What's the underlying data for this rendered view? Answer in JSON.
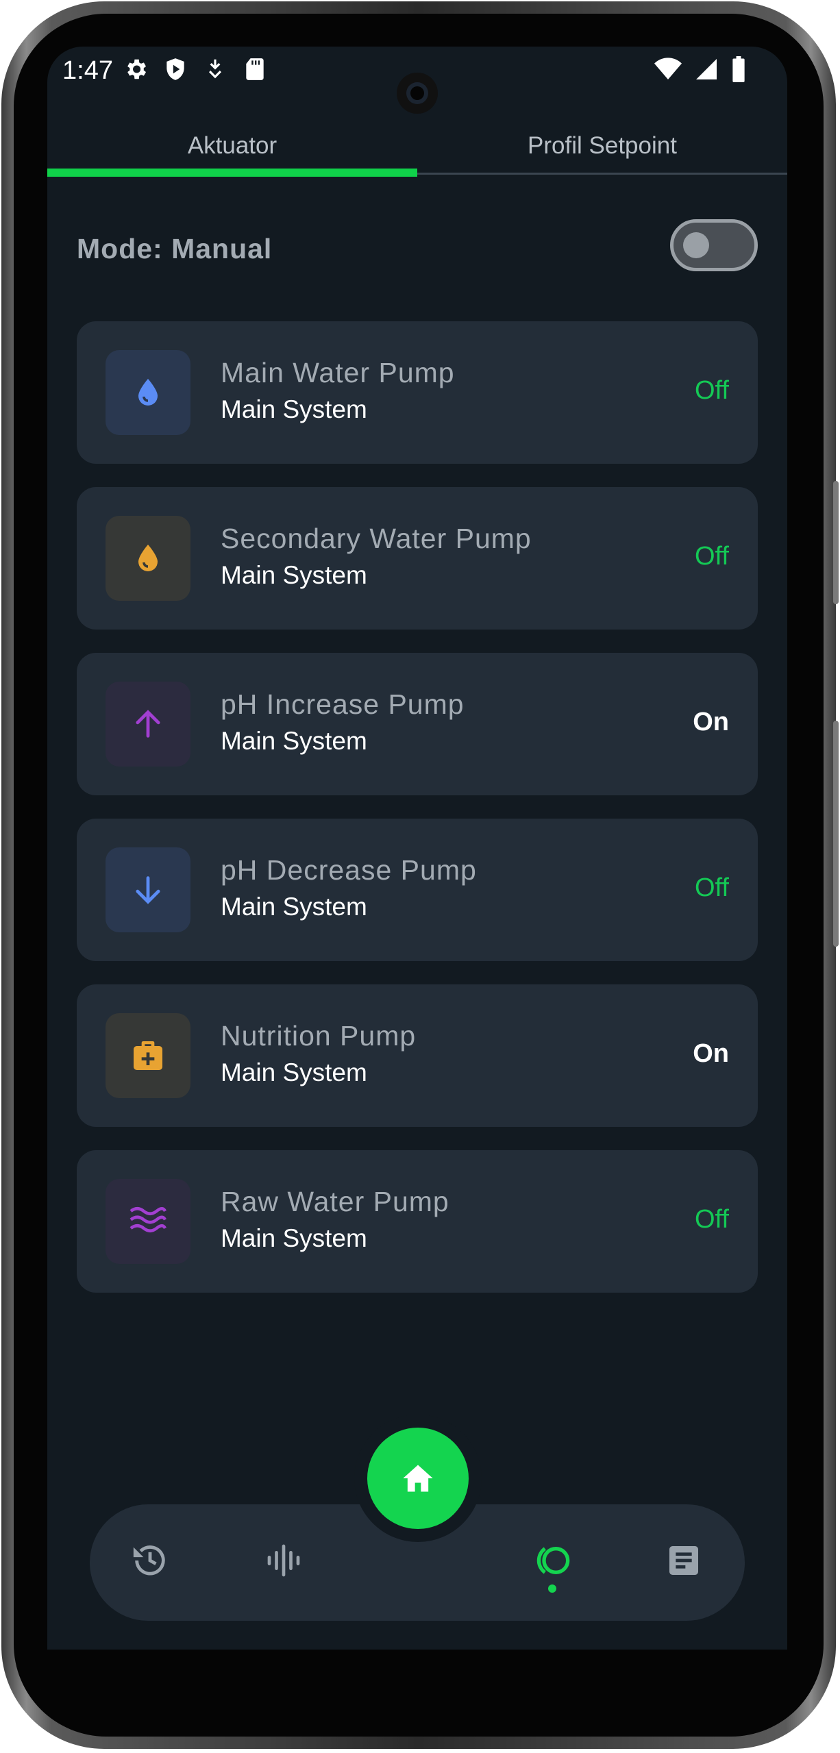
{
  "status_bar": {
    "time": "1:47",
    "left_icons": [
      "gear-icon",
      "shield-icon",
      "download-icon",
      "sd-card-icon"
    ],
    "right_icons": [
      "wifi-icon",
      "signal-icon",
      "battery-icon"
    ]
  },
  "tabs": [
    {
      "label": "Aktuator",
      "active": true
    },
    {
      "label": "Profil Setpoint",
      "active": false
    }
  ],
  "mode": {
    "label": "Mode: Manual",
    "toggle_on": false
  },
  "actuators": [
    {
      "name": "Main Water Pump",
      "system": "Main System",
      "status": "Off",
      "icon": "water-drop-icon",
      "icon_color": "#5b8cf5",
      "icon_bg": "#2a3850"
    },
    {
      "name": "Secondary Water Pump",
      "system": "Main System",
      "status": "Off",
      "icon": "water-drop-icon",
      "icon_color": "#e8a332",
      "icon_bg": "#363836"
    },
    {
      "name": "pH Increase Pump",
      "system": "Main System",
      "status": "On",
      "icon": "arrow-up-icon",
      "icon_color": "#a23fd1",
      "icon_bg": "#2c2b3f"
    },
    {
      "name": "pH Decrease Pump",
      "system": "Main System",
      "status": "Off",
      "icon": "arrow-down-icon",
      "icon_color": "#5b8cf5",
      "icon_bg": "#2a3850"
    },
    {
      "name": "Nutrition Pump",
      "system": "Main System",
      "status": "On",
      "icon": "medical-kit-icon",
      "icon_color": "#e8a332",
      "icon_bg": "#363836"
    },
    {
      "name": "Raw Water Pump",
      "system": "Main System",
      "status": "Off",
      "icon": "waves-icon",
      "icon_color": "#a23fd1",
      "icon_bg": "#2c2b3f"
    }
  ],
  "nav": {
    "items": [
      "history-icon",
      "waveform-icon",
      "home-icon",
      "actuator-icon",
      "notes-icon"
    ],
    "active": "actuator-icon",
    "accent": "#14d44f"
  }
}
